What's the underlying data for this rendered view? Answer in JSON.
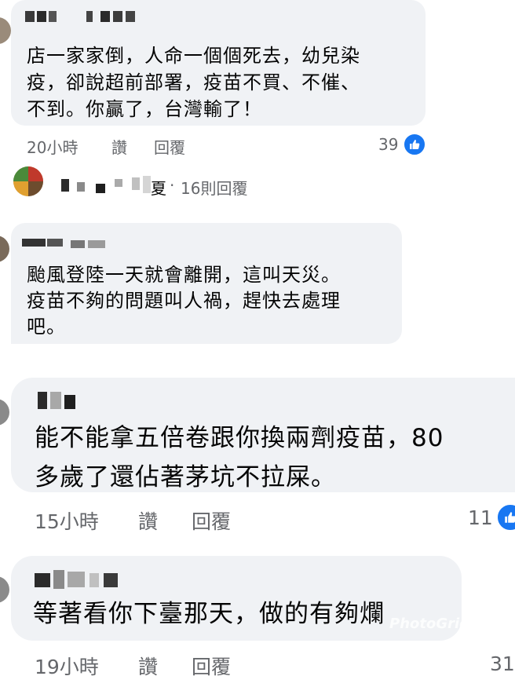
{
  "comments": [
    {
      "text": "店一家家倒，人命一個個死去，幼兒染\n疫，卻說超前部署，疫苗不買、不催、\n不到。你贏了，台灣輸了！",
      "time": "20小時",
      "like_action": "讚",
      "reply_action": "回覆",
      "likes": "39"
    },
    {
      "text": "颱風登陸一天就會離開，這叫天災。\n疫苗不夠的問題叫人禍，趕快去處理\n吧。"
    },
    {
      "text": "能不能拿五倍卷跟你換兩劑疫苗，80\n多歲了還佔著茅坑不拉屎。",
      "time": "15小時",
      "like_action": "讚",
      "reply_action": "回覆",
      "likes": "11"
    },
    {
      "text": "等著看你下臺那天，做的有夠爛",
      "time": "19小時",
      "like_action": "讚",
      "reply_action": "回覆",
      "likes": "31"
    }
  ],
  "replies_link": {
    "trailing_char": "夏",
    "separator": "·",
    "text": "16則回覆"
  },
  "watermark": "PhotoGrid",
  "colors": {
    "bubble": "#f0f2f5",
    "meta_text": "#65676b",
    "like_badge": "#1877f2"
  },
  "icons": [
    "thumbs-up-icon"
  ]
}
